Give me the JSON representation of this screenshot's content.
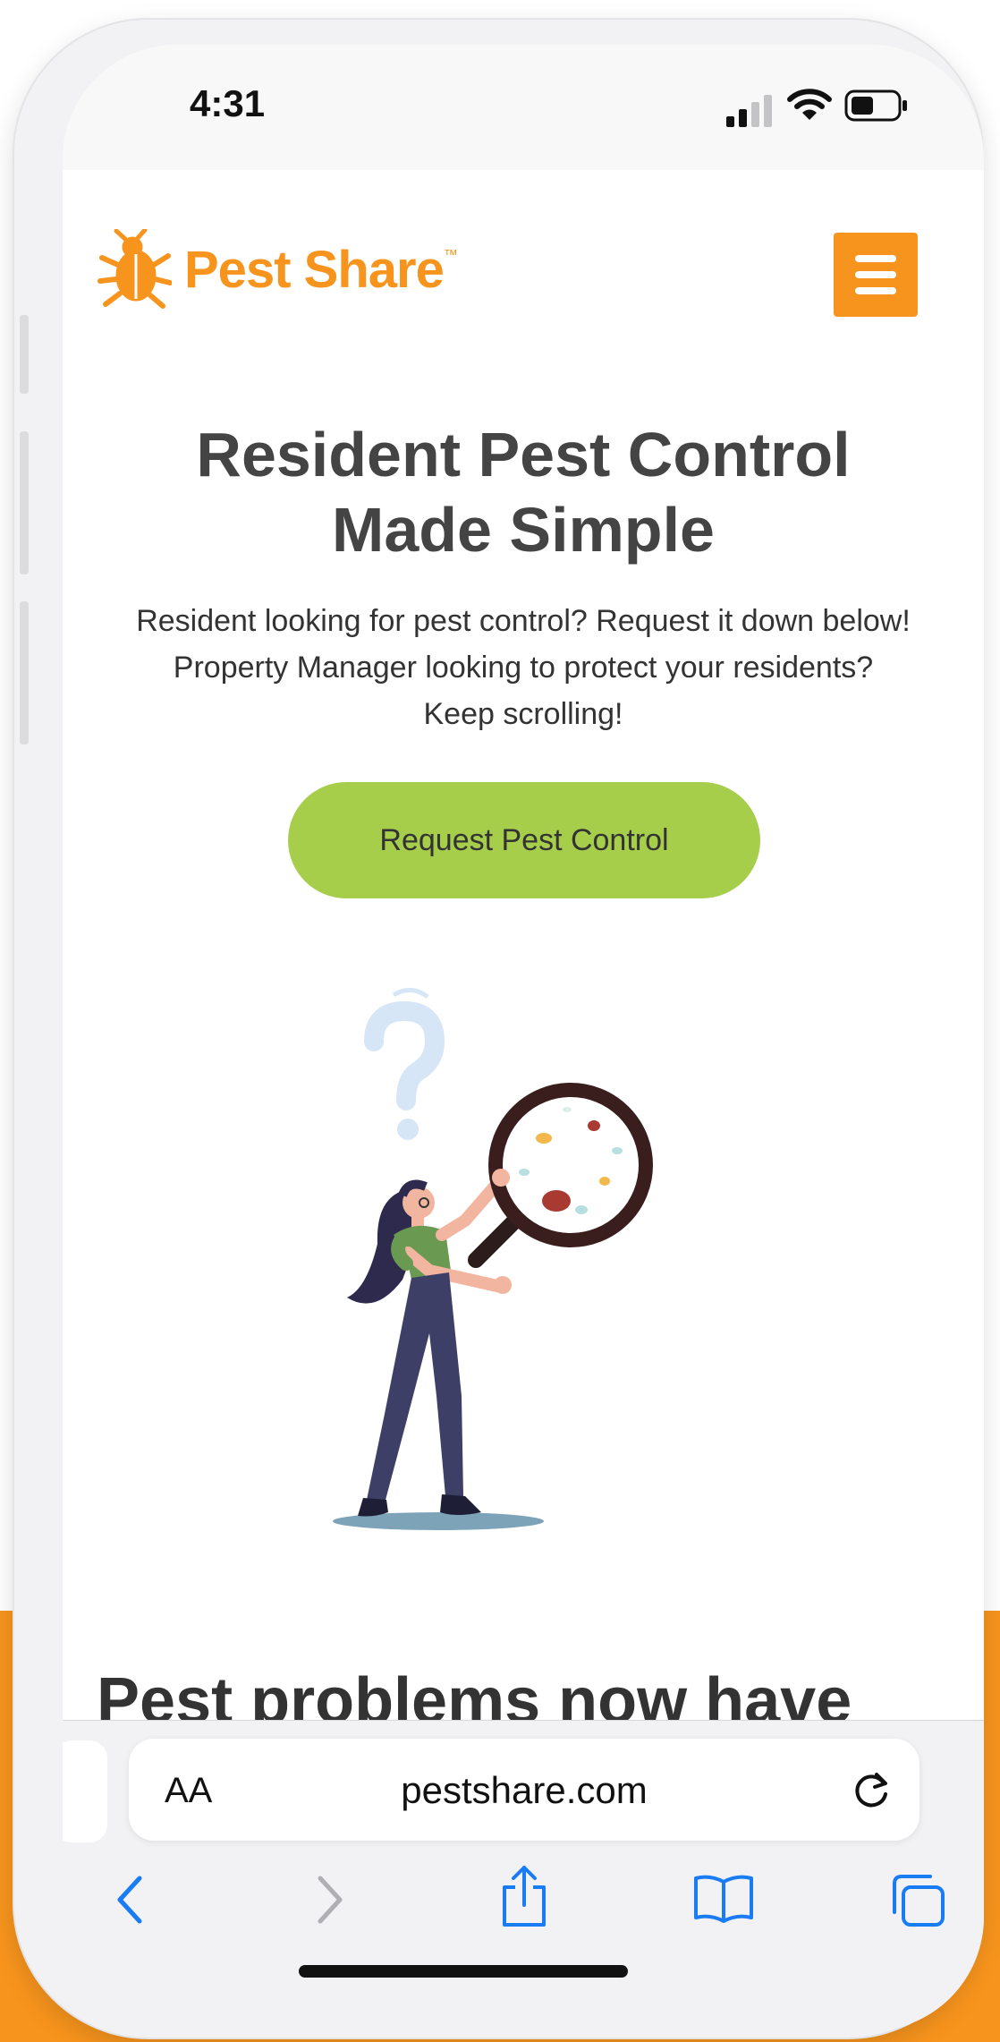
{
  "status_bar": {
    "time": "4:31"
  },
  "site": {
    "logo_text": "Pest Share",
    "logo_tm": "™",
    "hero": {
      "title_line1": "Resident Pest Control",
      "title_line2": "Made Simple",
      "sub_line1": "Resident looking for pest control? Request it down below!",
      "sub_line2": "Property Manager looking to protect your residents?",
      "sub_line3": "Keep scrolling!",
      "cta_label": "Request Pest Control"
    },
    "section_title": "Pest problems now have"
  },
  "browser": {
    "text_size_label": "AA",
    "url": "pestshare.com"
  },
  "icons": {
    "logo": "beetle-icon",
    "menu": "hamburger-menu-icon",
    "reload": "reload-icon",
    "back": "chevron-left-icon",
    "forward": "chevron-right-icon",
    "share": "share-icon",
    "bookmarks": "book-icon",
    "tabs": "tabs-icon"
  },
  "colors": {
    "brand_orange": "#f7941d",
    "cta_green": "#a6ce4b",
    "ios_blue": "#1a7cf5"
  }
}
